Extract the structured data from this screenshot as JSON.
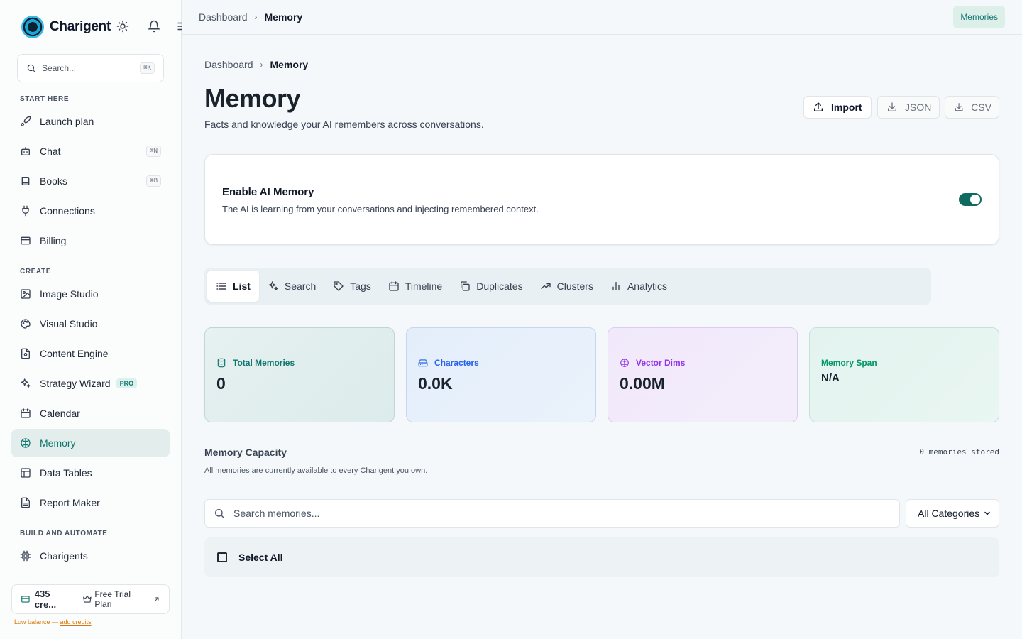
{
  "brand": {
    "name": "Charigent"
  },
  "sidebar": {
    "search_placeholder": "Search...",
    "search_shortcut": "⌘K",
    "sections": {
      "start": "START HERE",
      "create": "CREATE",
      "build": "BUILD AND AUTOMATE"
    },
    "items": [
      {
        "label": "Launch plan",
        "icon": "rocket-icon"
      },
      {
        "label": "Chat",
        "icon": "bot-icon",
        "shortcut": "⌘N"
      },
      {
        "label": "Books",
        "icon": "book-icon",
        "shortcut": "⌘B"
      },
      {
        "label": "Connections",
        "icon": "plug-icon"
      },
      {
        "label": "Billing",
        "icon": "credit-card-icon"
      },
      {
        "label": "Image Studio",
        "icon": "image-icon"
      },
      {
        "label": "Visual Studio",
        "icon": "palette-icon"
      },
      {
        "label": "Content Engine",
        "icon": "file-text-icon"
      },
      {
        "label": "Strategy Wizard",
        "icon": "sparkles-icon",
        "badge": "PRO"
      },
      {
        "label": "Calendar",
        "icon": "calendar-icon"
      },
      {
        "label": "Memory",
        "icon": "brain-icon",
        "active": true
      },
      {
        "label": "Data Tables",
        "icon": "table-icon"
      },
      {
        "label": "Report Maker",
        "icon": "report-icon"
      },
      {
        "label": "Charigents",
        "icon": "cpu-icon"
      }
    ],
    "credits": {
      "amount": "435 cre...",
      "plan": "Free Trial Plan"
    },
    "low_balance": {
      "text": "Low balance — ",
      "link": "add credits"
    }
  },
  "topbar": {
    "breadcrumb": [
      "Dashboard",
      "Memory"
    ],
    "badge": "Memories"
  },
  "page": {
    "breadcrumb": [
      "Dashboard",
      "Memory"
    ],
    "title": "Memory",
    "subtitle": "Facts and knowledge your AI remembers across conversations.",
    "actions": {
      "import": "Import",
      "json": "JSON",
      "csv": "CSV"
    }
  },
  "enable_card": {
    "title": "Enable AI Memory",
    "description": "The AI is learning from your conversations and injecting remembered context.",
    "enabled": true
  },
  "tabs": [
    {
      "label": "List",
      "icon": "list-icon",
      "active": true
    },
    {
      "label": "Search",
      "icon": "sparkles-icon"
    },
    {
      "label": "Tags",
      "icon": "tag-icon"
    },
    {
      "label": "Timeline",
      "icon": "calendar-icon"
    },
    {
      "label": "Duplicates",
      "icon": "copy-icon"
    },
    {
      "label": "Clusters",
      "icon": "trending-icon"
    },
    {
      "label": "Analytics",
      "icon": "bar-chart-icon"
    }
  ],
  "stats": [
    {
      "label": "Total Memories",
      "value": "0",
      "icon": "database-icon",
      "color": "#0f766e"
    },
    {
      "label": "Characters",
      "value": "0.0K",
      "icon": "drive-icon",
      "color": "#2563eb"
    },
    {
      "label": "Vector Dims",
      "value": "0.00M",
      "icon": "brain-icon",
      "color": "#9333ea"
    },
    {
      "label": "Memory Span",
      "value": "N/A",
      "icon": "",
      "color": "#059669"
    }
  ],
  "capacity": {
    "title": "Memory Capacity",
    "stored": "0 memories stored",
    "note": "All memories are currently available to every Charigent you own."
  },
  "memory_search": {
    "placeholder": "Search memories...",
    "category": "All Categories"
  },
  "select_all": "Select All",
  "colors": {
    "accent": "#0f766e",
    "warning": "#d97706"
  }
}
